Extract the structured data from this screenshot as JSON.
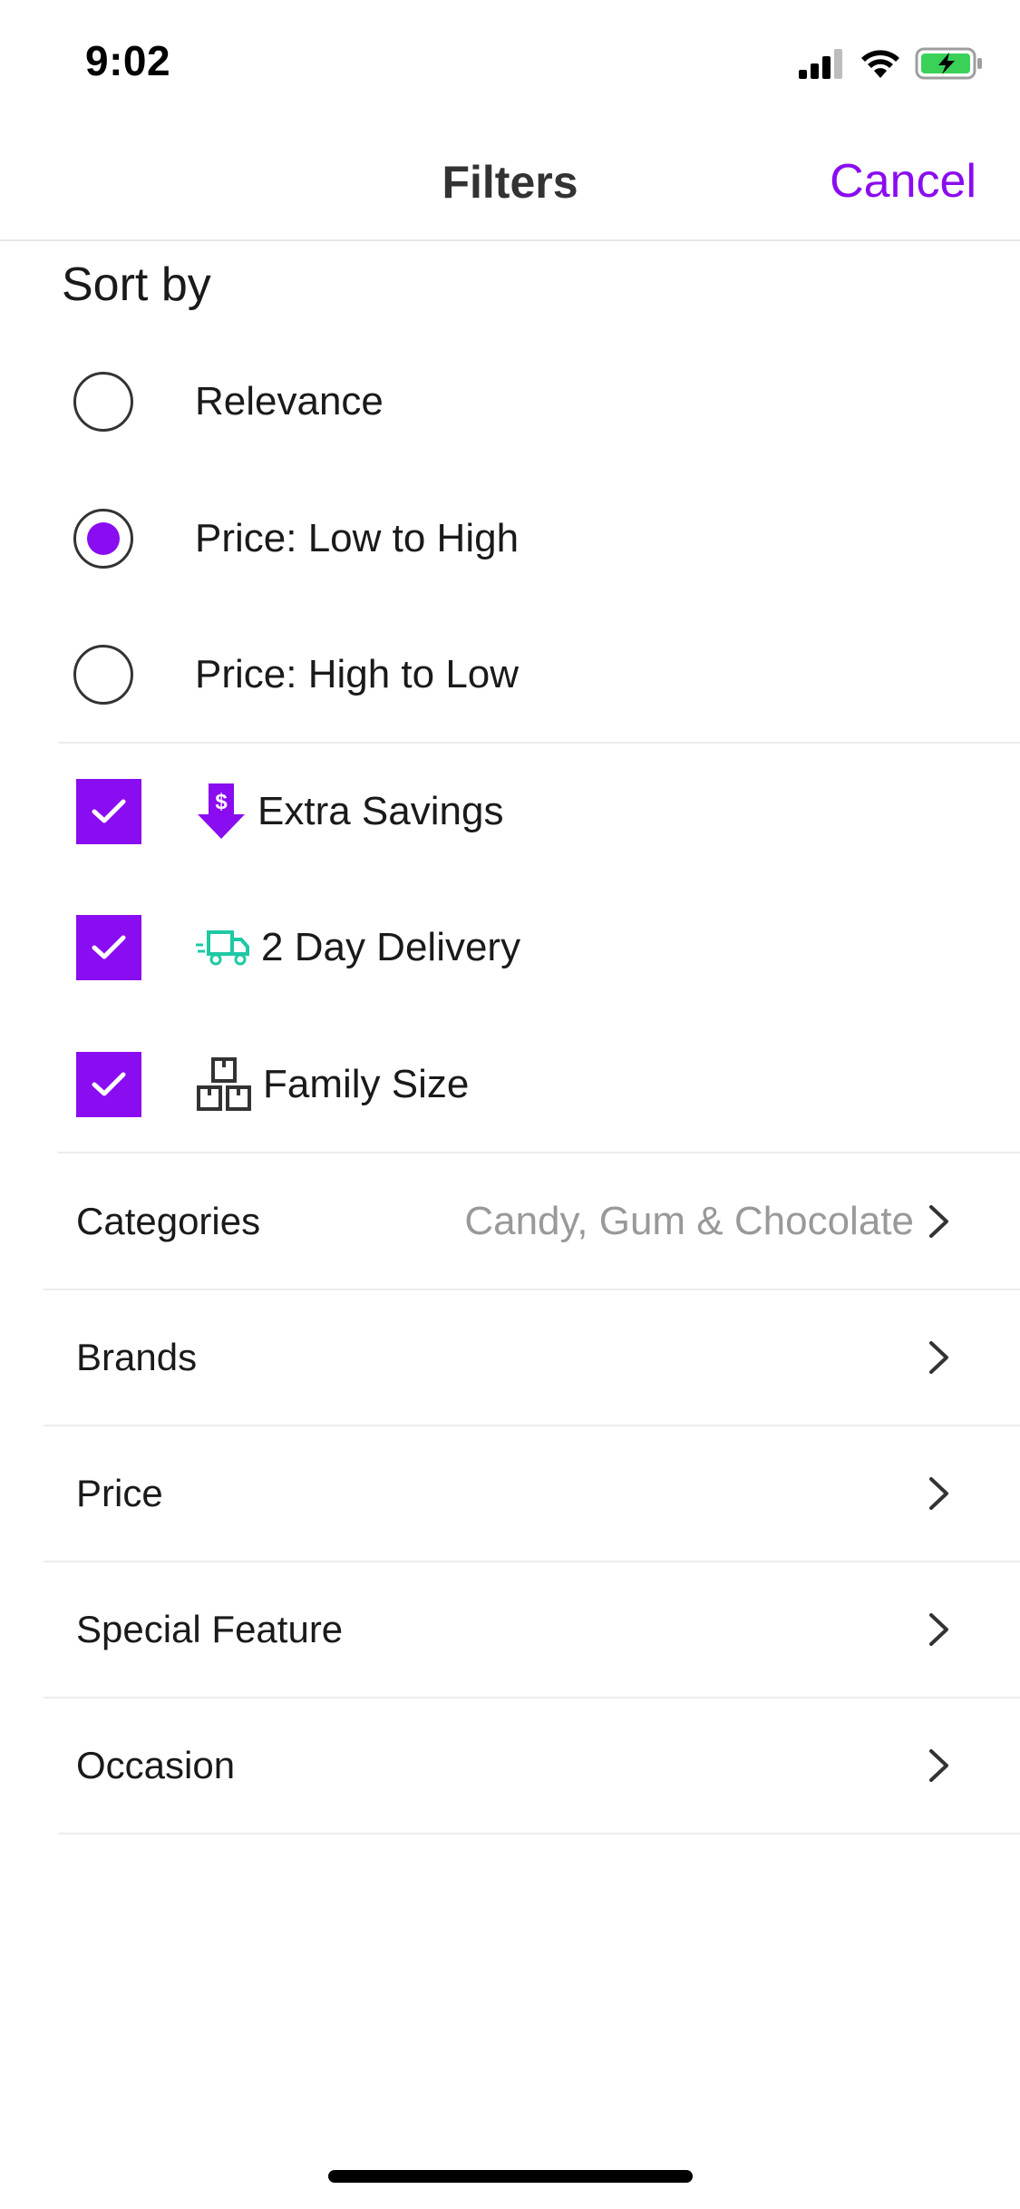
{
  "status_bar": {
    "time": "9:02",
    "icons": [
      "signal-icon",
      "wifi-icon",
      "battery-charging-icon"
    ]
  },
  "header": {
    "title": "Filters",
    "cancel_label": "Cancel"
  },
  "sort": {
    "title": "Sort by",
    "options": [
      {
        "label": "Relevance",
        "selected": false
      },
      {
        "label": "Price: Low to High",
        "selected": true
      },
      {
        "label": "Price: High to Low",
        "selected": false
      }
    ]
  },
  "toggles": [
    {
      "label": "Extra Savings",
      "checked": true,
      "icon": "savings-arrow-icon"
    },
    {
      "label": "2 Day Delivery",
      "checked": true,
      "icon": "delivery-truck-icon"
    },
    {
      "label": "Family Size",
      "checked": true,
      "icon": "boxes-icon"
    }
  ],
  "filters": [
    {
      "label": "Categories",
      "value": "Candy, Gum & Chocolate"
    },
    {
      "label": "Brands",
      "value": ""
    },
    {
      "label": "Price",
      "value": ""
    },
    {
      "label": "Special Feature",
      "value": ""
    },
    {
      "label": "Occasion",
      "value": ""
    }
  ],
  "colors": {
    "accent": "#8a0cf0",
    "delivery_icon": "#1ec9a5",
    "secondary_text": "#999999"
  }
}
